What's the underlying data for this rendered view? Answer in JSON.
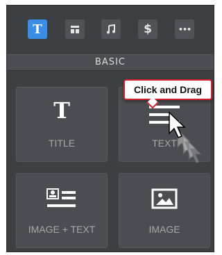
{
  "toolbar": {
    "buttons": [
      {
        "id": "text",
        "label": "T",
        "icon": "text-icon",
        "active": true
      },
      {
        "id": "layout",
        "label": "",
        "icon": "layout-icon",
        "active": false
      },
      {
        "id": "music",
        "label": "",
        "icon": "music-note-icon",
        "active": false
      },
      {
        "id": "commerce",
        "label": "$",
        "icon": "dollar-icon",
        "active": false
      },
      {
        "id": "more",
        "label": "•••",
        "icon": "more-icon",
        "active": false
      }
    ]
  },
  "section": {
    "title": "BASIC"
  },
  "tiles": [
    {
      "label": "TITLE",
      "icon": "title-icon"
    },
    {
      "label": "TEXT",
      "icon": "text-lines-icon"
    },
    {
      "label": "IMAGE + TEXT",
      "icon": "image-text-icon"
    },
    {
      "label": "IMAGE",
      "icon": "image-icon"
    }
  ],
  "tooltip": {
    "text": "Click and Drag"
  },
  "colors": {
    "panel": "#3d4043",
    "tile": "#4a4d51",
    "accent": "#3a8ee6",
    "tooltip_border": "#d4202b"
  }
}
